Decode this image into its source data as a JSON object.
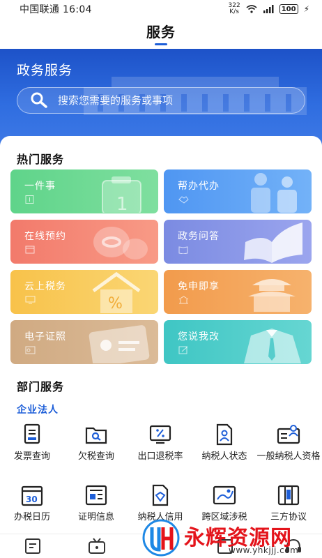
{
  "status_bar": {
    "carrier_time": "中国联通 16:04",
    "net_speed_value": "322",
    "net_speed_unit": "K/s",
    "battery": "100"
  },
  "header": {
    "title": "服务"
  },
  "hero": {
    "title": "政务服务",
    "search_placeholder": "搜索您需要的服务或事项"
  },
  "hot_services": {
    "title": "热门服务",
    "cards": [
      {
        "label": "一件事",
        "color": "#5fd48a"
      },
      {
        "label": "帮办代办",
        "color": "#4f96f2"
      },
      {
        "label": "在线预约",
        "color": "#f27a6b"
      },
      {
        "label": "政务问答",
        "color": "#7b8be2"
      },
      {
        "label": "云上税务",
        "color": "#f8c24a"
      },
      {
        "label": "免申即享",
        "color": "#f29b4c"
      },
      {
        "label": "电子证照",
        "color": "#d0aa82"
      },
      {
        "label": "您说我改",
        "color": "#3fc6c4"
      }
    ]
  },
  "dept_services": {
    "title": "部门服务",
    "subtitle": "企业法人",
    "items": [
      {
        "label": "发票查询",
        "icon": "invoice-icon"
      },
      {
        "label": "欠税查询",
        "icon": "folder-search-icon"
      },
      {
        "label": "出口退税率",
        "icon": "percent-icon"
      },
      {
        "label": "纳税人状态",
        "icon": "person-doc-icon"
      },
      {
        "label": "一般纳税人资格",
        "icon": "id-card-icon"
      },
      {
        "label": "办税日历",
        "icon": "calendar-icon"
      },
      {
        "label": "证明信息",
        "icon": "certificate-icon"
      },
      {
        "label": "纳税人信用",
        "icon": "credit-icon"
      },
      {
        "label": "跨区域涉税",
        "icon": "map-icon"
      },
      {
        "label": "三方协议",
        "icon": "agreement-icon"
      }
    ]
  },
  "watermark": {
    "name": "永辉资源网",
    "url": "www.yhkjjj.com"
  },
  "accent_color": "#1d5ed8"
}
